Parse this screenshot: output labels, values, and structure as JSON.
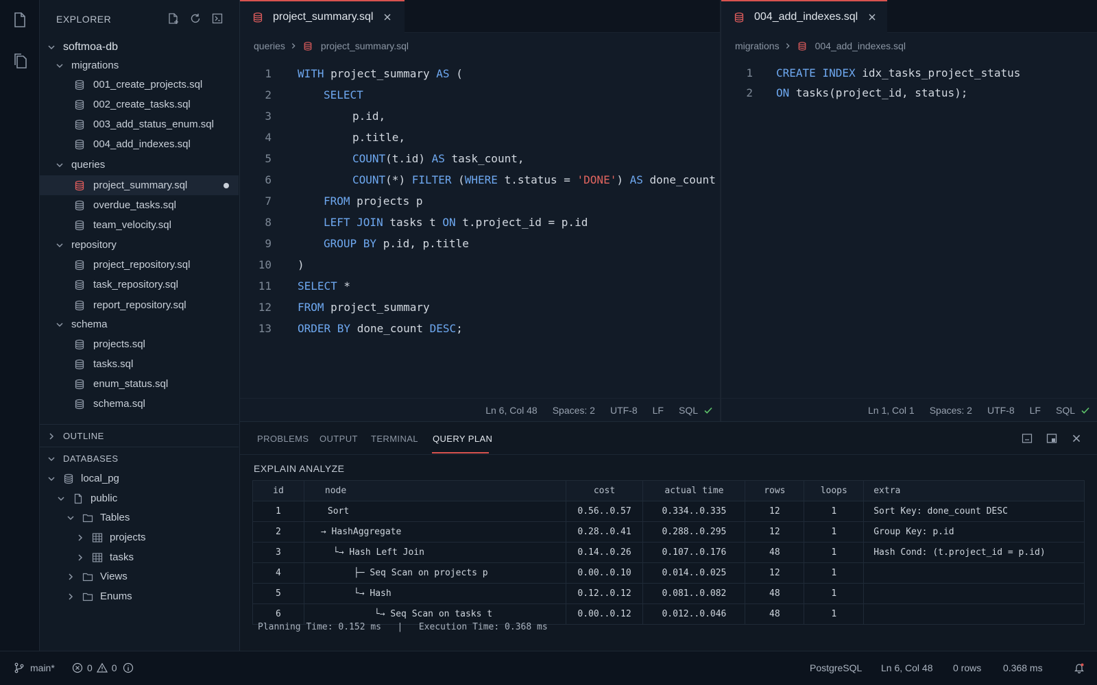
{
  "sidebar": {
    "title": "EXPLORER",
    "root": "softmoa-db",
    "migrations": {
      "label": "migrations",
      "files": [
        "001_create_projects.sql",
        "002_create_tasks.sql",
        "003_add_status_enum.sql",
        "004_add_indexes.sql"
      ]
    },
    "queries": {
      "label": "queries",
      "files": [
        "project_summary.sql",
        "overdue_tasks.sql",
        "team_velocity.sql"
      ]
    },
    "repository": {
      "label": "repository",
      "files": [
        "project_repository.sql",
        "task_repository.sql",
        "report_repository.sql"
      ]
    },
    "schema": {
      "label": "schema",
      "files": [
        "projects.sql",
        "tasks.sql",
        "enum_status.sql",
        "schema.sql"
      ]
    },
    "outline": "OUTLINE",
    "databases": {
      "label": "DATABASES",
      "connection": "local_pg",
      "schema": "public",
      "tables_label": "Tables",
      "tables": [
        "projects",
        "tasks"
      ],
      "views_label": "Views",
      "enums_label": "Enums"
    }
  },
  "editor_left": {
    "tab": "project_summary.sql",
    "breadcrumb": [
      "queries",
      "project_summary.sql"
    ],
    "line_numbers": [
      "1",
      "2",
      "3",
      "4",
      "5",
      "6",
      "7",
      "8",
      "9",
      "10",
      "11",
      "12",
      "13"
    ],
    "status": {
      "position": "Ln 6, Col 48",
      "spaces": "Spaces: 2",
      "encoding": "UTF-8",
      "eol": "LF",
      "language": "SQL"
    }
  },
  "editor_right": {
    "tab": "004_add_indexes.sql",
    "breadcrumb": [
      "migrations",
      "004_add_indexes.sql"
    ],
    "line_numbers": [
      "1",
      "2"
    ],
    "status": {
      "position": "Ln 1, Col 1",
      "spaces": "Spaces: 2",
      "encoding": "UTF-8",
      "eol": "LF",
      "language": "SQL"
    }
  },
  "panel": {
    "tabs": [
      "PROBLEMS",
      "OUTPUT",
      "TERMINAL",
      "QUERY PLAN"
    ],
    "active_tab": "QUERY PLAN",
    "heading": "EXPLAIN ANALYZE",
    "columns": [
      "id",
      "node",
      "cost",
      "actual time",
      "rows",
      "loops",
      "extra"
    ],
    "rows": [
      {
        "id": "1",
        "node": "Sort",
        "cost": "0.56..0.57",
        "time": "0.334..0.335",
        "rows": "12",
        "loops": "1",
        "extra": "Sort Key: done_count DESC"
      },
      {
        "id": "2",
        "node": "→ HashAggregate",
        "cost": "0.28..0.41",
        "time": "0.288..0.295",
        "rows": "12",
        "loops": "1",
        "extra": "Group Key: p.id"
      },
      {
        "id": "3",
        "node": "└→ Hash Left Join",
        "cost": "0.14..0.26",
        "time": "0.107..0.176",
        "rows": "48",
        "loops": "1",
        "extra": "Hash Cond: (t.project_id = p.id)"
      },
      {
        "id": "4",
        "node": "├─ Seq Scan on projects p",
        "cost": "0.00..0.10",
        "time": "0.014..0.025",
        "rows": "12",
        "loops": "1",
        "extra": ""
      },
      {
        "id": "5",
        "node": "└→ Hash",
        "cost": "0.12..0.12",
        "time": "0.081..0.082",
        "rows": "48",
        "loops": "1",
        "extra": ""
      },
      {
        "id": "6",
        "node": "└→ Seq Scan on tasks t",
        "cost": "0.00..0.12",
        "time": "0.012..0.046",
        "rows": "48",
        "loops": "1",
        "extra": ""
      }
    ],
    "planning": "Planning Time: 0.152 ms",
    "separator": "|",
    "execution": "Execution Time: 0.368 ms"
  },
  "statusbar": {
    "branch": "main*",
    "errors": "0",
    "warnings": "0",
    "engine": "PostgreSQL",
    "position": "Ln 6, Col 48",
    "rows": "0 rows",
    "time": "0.368 ms"
  },
  "colors": {
    "accent": "#d9534f",
    "keyword": "#6ea8f0",
    "string": "#e2655f",
    "ok": "#5ec26a"
  }
}
